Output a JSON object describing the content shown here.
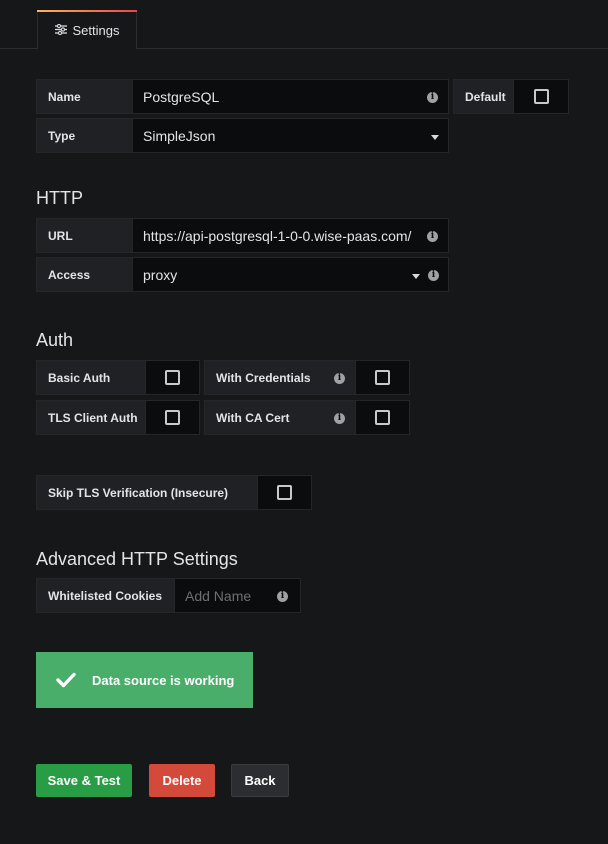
{
  "tabs": [
    {
      "label": "Settings",
      "icon": "sliders-icon"
    }
  ],
  "name_field": {
    "label": "Name",
    "value": "PostgreSQL",
    "info_icon": "info-icon"
  },
  "default_toggle": {
    "label": "Default",
    "checked": false
  },
  "type_field": {
    "label": "Type",
    "value": "SimpleJson"
  },
  "http": {
    "title": "HTTP",
    "url": {
      "label": "URL",
      "value": "https://api-postgresql-1-0-0.wise-paas.com/"
    },
    "access": {
      "label": "Access",
      "value": "proxy"
    }
  },
  "auth": {
    "title": "Auth",
    "basic_auth": {
      "label": "Basic Auth",
      "checked": false
    },
    "with_credentials": {
      "label": "With Credentials",
      "checked": false
    },
    "tls_client_auth": {
      "label": "TLS Client Auth",
      "checked": false
    },
    "with_ca_cert": {
      "label": "With CA Cert",
      "checked": false
    },
    "skip_tls": {
      "label": "Skip TLS Verification (Insecure)",
      "checked": false
    }
  },
  "advanced": {
    "title": "Advanced HTTP Settings",
    "whitelisted_cookies": {
      "label": "Whitelisted Cookies",
      "placeholder": "Add Name"
    }
  },
  "alert": {
    "text": "Data source is working",
    "status": "success"
  },
  "actions": {
    "save_label": "Save & Test",
    "delete_label": "Delete",
    "back_label": "Back"
  },
  "colors": {
    "background": "#161719",
    "success": "#48ae6a",
    "save": "#299c46",
    "delete": "#d44a3a",
    "back": "#2c2d30"
  }
}
